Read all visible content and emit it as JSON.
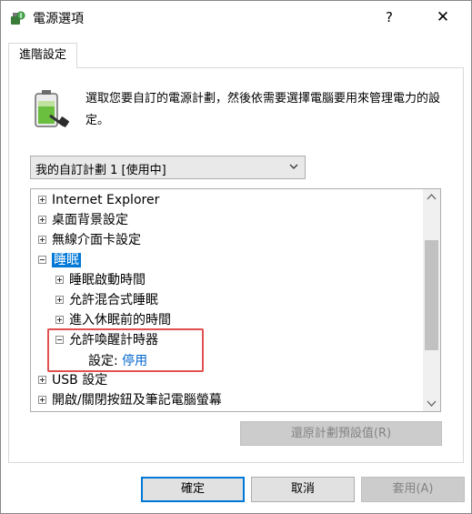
{
  "window": {
    "title": "電源選項",
    "help": "?",
    "close": "✕"
  },
  "tabs": [
    {
      "label": "進階設定",
      "selected": true
    }
  ],
  "description": "選取您要自訂的電源計劃，然後依需要選擇電腦要用來管理電力的設定。",
  "plan_select": {
    "value": "我的自訂計劃 1 [使用中]"
  },
  "tree": {
    "items": [
      {
        "label": "Internet Explorer",
        "expander": "plus",
        "level": 0
      },
      {
        "label": "桌面背景設定",
        "expander": "plus",
        "level": 0
      },
      {
        "label": "無線介面卡設定",
        "expander": "plus",
        "level": 0
      },
      {
        "label": "睡眠",
        "expander": "minus",
        "level": 0,
        "selected": true
      },
      {
        "label": "睡眠啟動時間",
        "expander": "plus",
        "level": 1
      },
      {
        "label": "允許混合式睡眠",
        "expander": "plus",
        "level": 1
      },
      {
        "label": "進入休眠前的時間",
        "expander": "plus",
        "level": 1
      },
      {
        "label": "允許喚醒計時器",
        "expander": "minus",
        "level": 1
      },
      {
        "label": "USB 設定",
        "expander": "plus",
        "level": 0
      },
      {
        "label": "開啟/關閉按鈕及筆記電腦螢幕",
        "expander": "plus",
        "level": 0
      }
    ],
    "setting": {
      "label": "設定:",
      "value": "停用"
    }
  },
  "buttons": {
    "restore": "還原計劃預設值(R)",
    "ok": "確定",
    "cancel": "取消",
    "apply": "套用(A)"
  },
  "colors": {
    "selection": "#0078d7",
    "link": "#0066cc",
    "highlight_box": "#e24f4f"
  }
}
